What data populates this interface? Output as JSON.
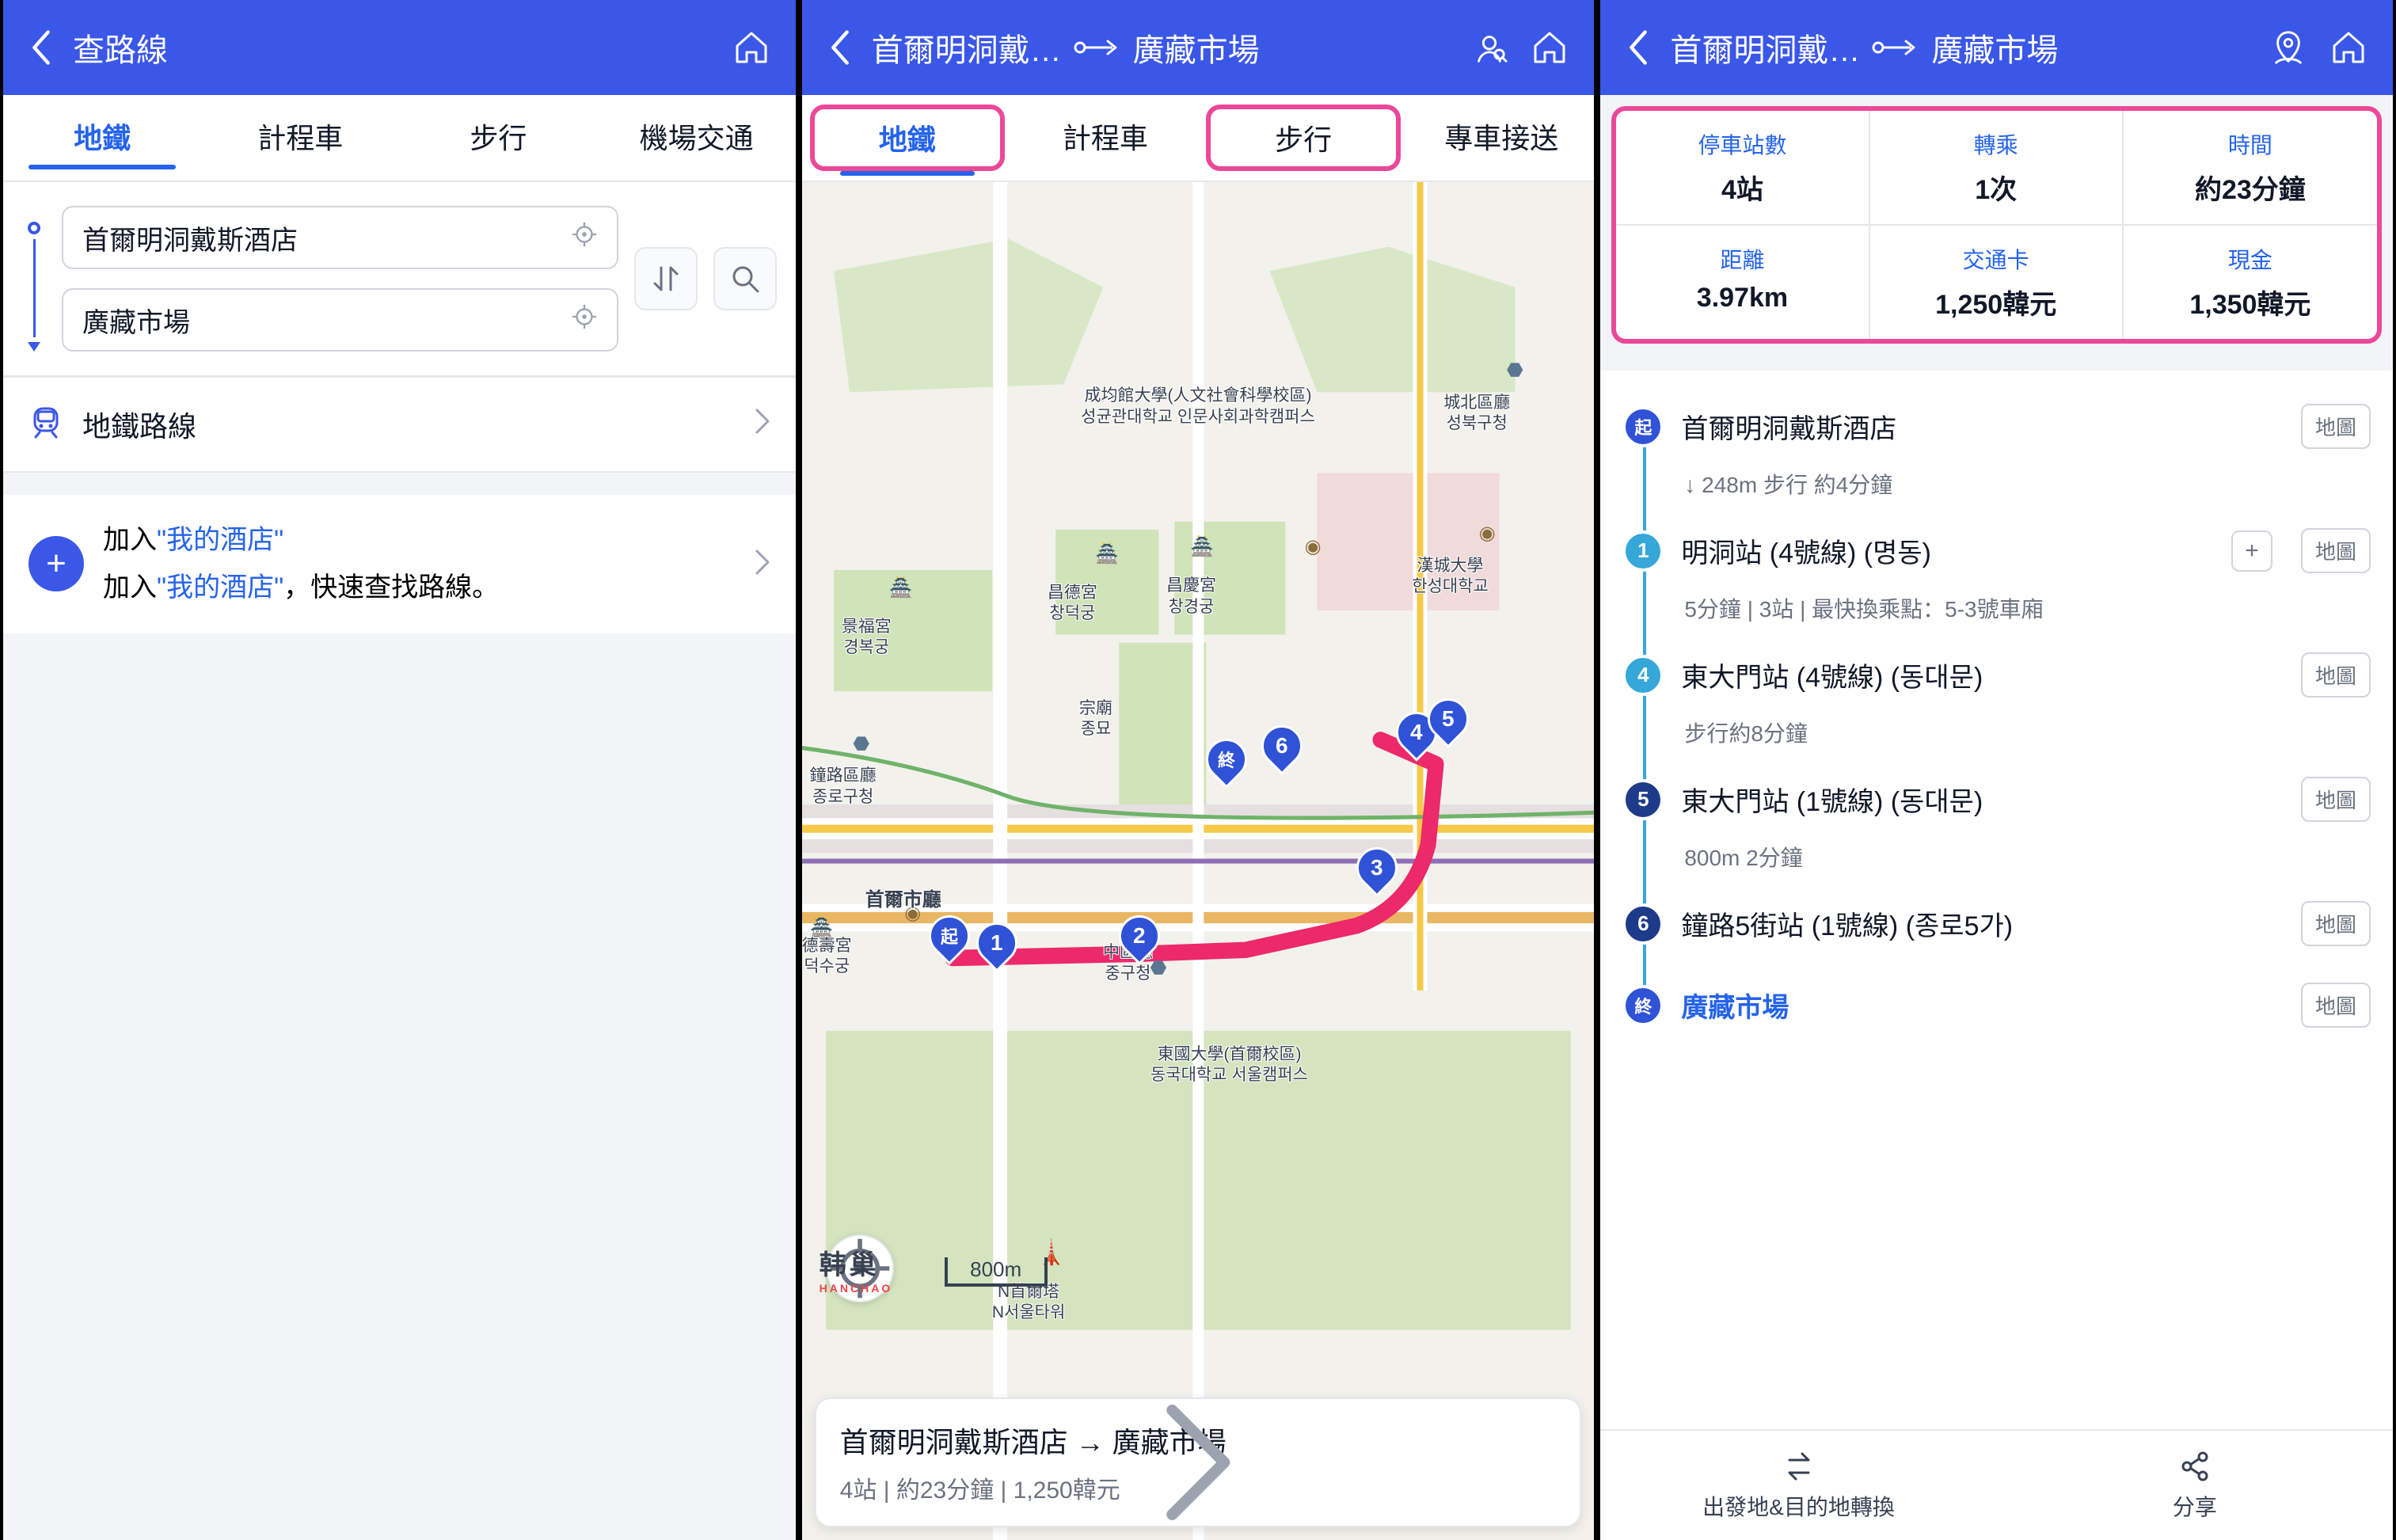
{
  "screen1": {
    "header_title": "查路線",
    "tabs": [
      "地鐵",
      "計程車",
      "步行",
      "機場交通"
    ],
    "input_from": "首爾明洞戴斯酒店",
    "input_to": "廣藏市場",
    "subway_line_label": "地鐵路線",
    "hotel_add_title_a": "加入",
    "hotel_add_title_b": "\"我的酒店\"",
    "hotel_add_desc_a": "加入",
    "hotel_add_desc_b": "\"我的酒店\"",
    "hotel_add_desc_c": "，快速查找路線。"
  },
  "screen2": {
    "header_from": "首爾明洞戴…",
    "header_to": "廣藏市場",
    "tabs": [
      "地鐵",
      "計程車",
      "步行",
      "專車接送"
    ],
    "scale": "800m",
    "brand": "韩巢",
    "brand_sub": "HANCHAO",
    "card_title": "首爾明洞戴斯酒店 → 廣藏市場",
    "card_sub": "4站 | 約23分鐘 | 1,250韓元",
    "pins": {
      "start": "起",
      "end": "終"
    },
    "labels": {
      "gyeongbok": {
        "zh": "景福宮",
        "ko": "경복궁"
      },
      "changdeok": {
        "zh": "昌德宮",
        "ko": "창덕궁"
      },
      "changgyeong": {
        "zh": "昌慶宮",
        "ko": "창경궁"
      },
      "sungkyun": {
        "zh": "成均館大學(人文社會科學校區)",
        "ko": "성균관대학교 인문사회과학캠퍼스"
      },
      "hansung": {
        "zh": "漢城大學",
        "ko": "한성대학교"
      },
      "seongbuk": {
        "zh": "城北區廳",
        "ko": "성북구청"
      },
      "jongmyo": {
        "zh": "宗廟",
        "ko": "종묘"
      },
      "jongno": {
        "zh": "鐘路區廳",
        "ko": "종로구청"
      },
      "deoksu": {
        "zh": "德壽宮",
        "ko": "덕수궁"
      },
      "cityhall": {
        "zh": "首爾市廳",
        "ko": ""
      },
      "junggu": {
        "zh": "中區廳",
        "ko": "중구청"
      },
      "dongguk": {
        "zh": "東國大學(首爾校區)",
        "ko": "동국대학교 서울캠퍼스"
      },
      "nseoul": {
        "zh": "N首爾塔",
        "ko": "N서울타워"
      }
    }
  },
  "screen3": {
    "header_from": "首爾明洞戴…",
    "header_to": "廣藏市場",
    "stats": [
      {
        "lbl": "停車站數",
        "val": "4站"
      },
      {
        "lbl": "轉乘",
        "val": "1次"
      },
      {
        "lbl": "時間",
        "val": "約23分鐘"
      },
      {
        "lbl": "距離",
        "val": "3.97km"
      },
      {
        "lbl": "交通卡",
        "val": "1,250韓元"
      },
      {
        "lbl": "現金",
        "val": "1,350韓元"
      }
    ],
    "steps": {
      "start_badge": "起",
      "start": "首爾明洞戴斯酒店",
      "walk1": "↓ 248m 步行 約4分鐘",
      "s1": "明洞站 (4號線) (명동)",
      "s1_sub": "5分鐘 | 3站 | 最快換乘點：5-3號車廂",
      "s4": "東大門站 (4號線) (동대문)",
      "walk2": "步行約8分鐘",
      "s5": "東大門站 (1號線) (동대문)",
      "s5_sub": "800m 2分鐘",
      "s6": "鐘路5街站 (1號線) (종로5가)",
      "end_badge": "終",
      "end": "廣藏市場"
    },
    "map_btn": "地圖",
    "bottom_swap": "出發地&目的地轉換",
    "bottom_share": "分享"
  }
}
